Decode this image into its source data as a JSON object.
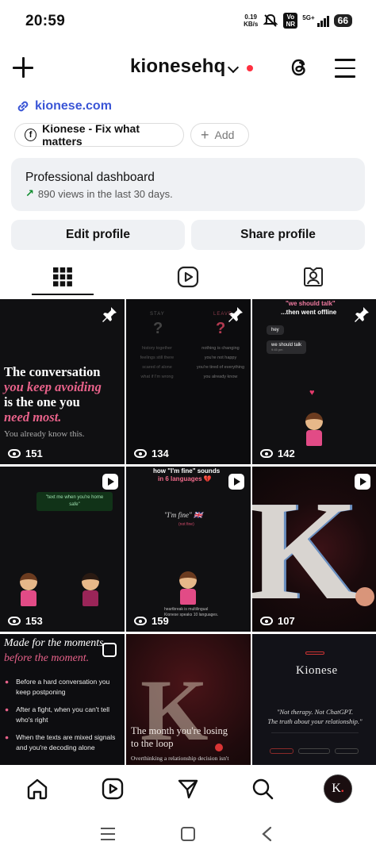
{
  "status": {
    "time": "20:59",
    "speed_value": "0.19",
    "speed_unit": "KB/s",
    "volte": "Vo NR",
    "network": "5G+",
    "battery": "66"
  },
  "header": {
    "username": "kionesehq"
  },
  "profile": {
    "link": "kionese.com",
    "facebook_chip": "Kionese - Fix what matters",
    "add_chip": "Add",
    "dashboard_title": "Professional dashboard",
    "dashboard_sub": "890 views in the last 30 days.",
    "edit_profile": "Edit profile",
    "share_profile": "Share profile"
  },
  "posts": [
    {
      "views": "151",
      "line1": "The conversation",
      "line2": "you keep avoiding",
      "line3": "is the one you",
      "line4": "need most.",
      "line5": "You already know this."
    },
    {
      "views": "134",
      "col1_head": "STAY",
      "col2_head": "LEAVE",
      "col1": [
        "history together",
        "feelings still there",
        "scared of alone",
        "what if I'm wrong"
      ],
      "col2": [
        "nothing is changing",
        "you're not happy",
        "you're tired of everything",
        "you already know"
      ]
    },
    {
      "views": "142",
      "title1": "\"we should talk\"",
      "title2": "...then went offline",
      "msg1": "hey",
      "msg2": "we should talk",
      "msg_time": "9:45 pm"
    },
    {
      "views": "153",
      "text": "\"text me when you're home safe\""
    },
    {
      "views": "159",
      "title1": "how \"I'm fine\" sounds",
      "title2": "in 6 languages 💔",
      "quote": "\"I'm fine\" 🇬🇧",
      "sub": "(not fine)",
      "foot1": "heartbreak is multilingual",
      "foot2": "Kionese speaks 10 languages."
    },
    {
      "views": "107",
      "letter": "K"
    },
    {
      "title1": "Made for the moments",
      "title2": "before the moment.",
      "bullets": [
        "Before a hard conversation you keep postponing",
        "After a fight, when you can't tell who's right",
        "When the texts are mixed signals and you're decoding alone"
      ]
    },
    {
      "letter": "K",
      "title1": "The month you're losing",
      "title2": "to the loop",
      "sub": "Overthinking a relationship decision isn't"
    },
    {
      "brand": "Kionese",
      "quote1": "\"Not therapy. Not ChatGPT.",
      "quote2": "The truth about your relationship.\""
    }
  ],
  "avatar_letter": "K",
  "colors": {
    "accent_link": "#3b56d6",
    "pink": "#e8628a",
    "notification_dot": "#ff3040"
  }
}
